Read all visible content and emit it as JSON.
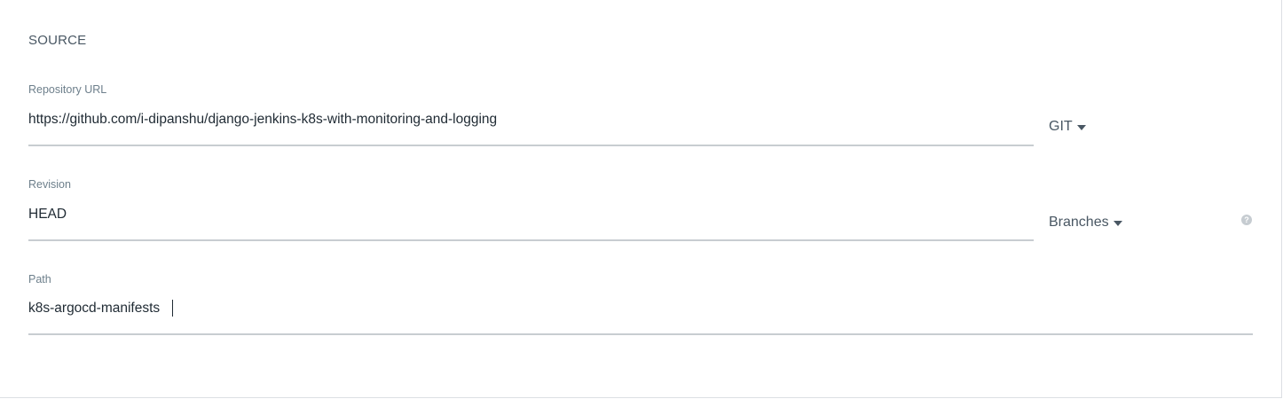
{
  "source": {
    "title": "SOURCE",
    "repo_url": {
      "label": "Repository URL",
      "value": "https://github.com/i-dipanshu/django-jenkins-k8s-with-monitoring-and-logging",
      "type_selector": "GIT"
    },
    "revision": {
      "label": "Revision",
      "value": "HEAD",
      "ref_selector": "Branches"
    },
    "path": {
      "label": "Path",
      "value": "k8s-argocd-manifests"
    },
    "help_icon_glyph": "?"
  },
  "icons": {
    "caret": "caret-down-icon",
    "help": "question-circle-icon"
  },
  "colors": {
    "text_primary": "#1f2a33",
    "text_secondary": "#495763",
    "label": "#6d7f8b",
    "underline": "#c8cdd1",
    "help_icon": "#c6ccd1"
  }
}
